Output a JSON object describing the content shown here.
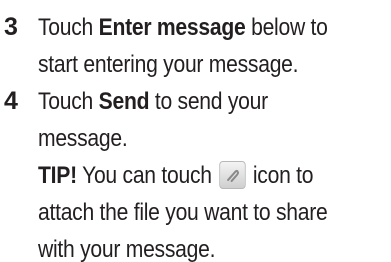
{
  "steps": [
    {
      "number": "3",
      "lines": [
        {
          "pre": "Touch ",
          "bold": "Enter message",
          "post": " below to"
        },
        {
          "text": "start entering your message."
        }
      ]
    },
    {
      "number": "4",
      "lines": [
        {
          "pre": "Touch ",
          "bold": "Send",
          "post": " to send your"
        },
        {
          "text": "message."
        }
      ],
      "tip": {
        "label": "TIP!",
        "line1_pre": " You can touch ",
        "icon": "paperclip-attach-icon",
        "line1_post": " icon to",
        "line2": "attach the file you want to share",
        "line3": "with your message."
      }
    }
  ]
}
